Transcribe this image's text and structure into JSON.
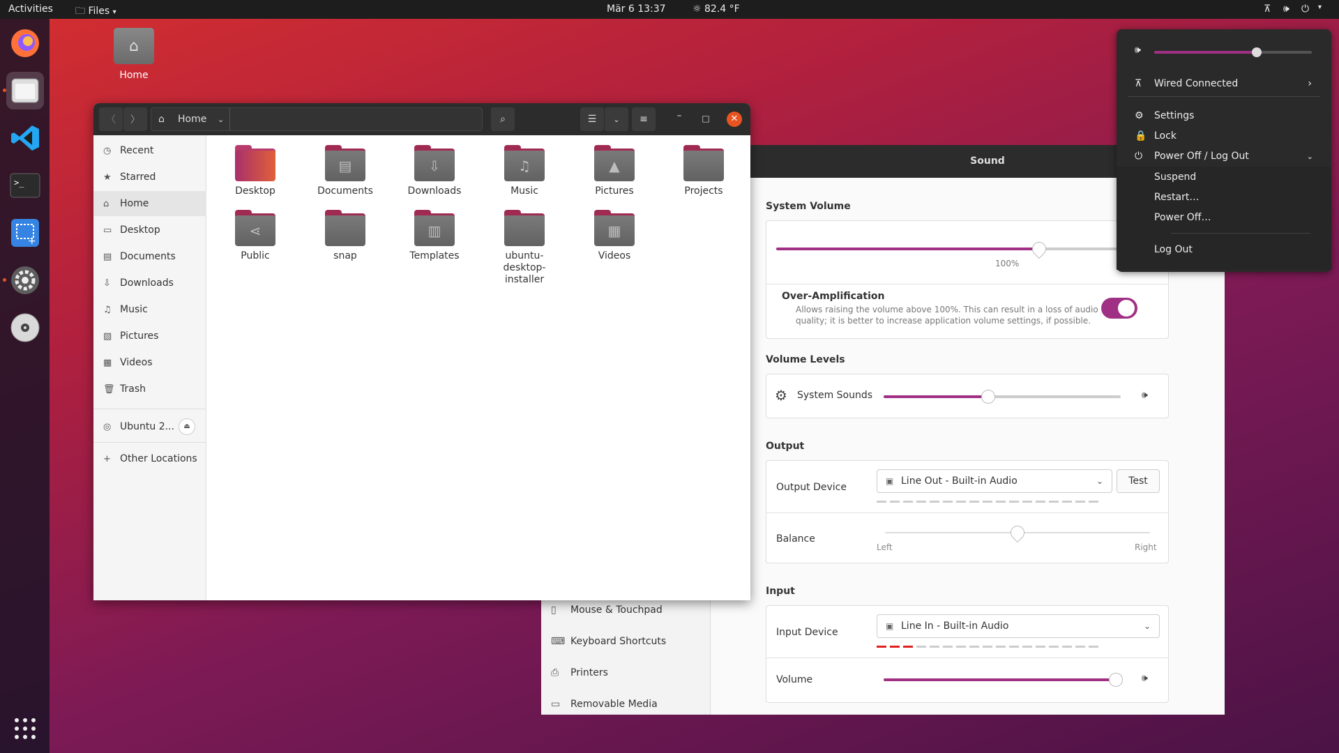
{
  "topbar": {
    "activities": "Activities",
    "app_menu": "Files",
    "clock": "Mär 6  13:37",
    "weather": "82.4 °F"
  },
  "desktop": {
    "home_label": "Home"
  },
  "settings": {
    "header_title": "Sound",
    "sidebar": [
      {
        "label": "Mouse & Touchpad",
        "icon": "mouse-icon"
      },
      {
        "label": "Keyboard Shortcuts",
        "icon": "keyboard-icon"
      },
      {
        "label": "Printers",
        "icon": "printer-icon"
      },
      {
        "label": "Removable Media",
        "icon": "usb-icon"
      }
    ],
    "system_volume": {
      "title": "System Volume",
      "percent_label": "100%",
      "level": 0.67
    },
    "over_amp": {
      "title": "Over-Amplification",
      "desc_line1": "Allows raising the volume above 100%. This can result in a loss of audio",
      "desc_line2": "quality; it is better to increase application volume settings, if possible.",
      "enabled": true
    },
    "volume_levels": {
      "title": "Volume Levels",
      "system_sounds": "System Sounds",
      "level": 0.44
    },
    "output": {
      "title": "Output",
      "device_label": "Output Device",
      "device": "Line Out - Built-in Audio",
      "test": "Test",
      "balance_label": "Balance",
      "left": "Left",
      "right": "Right",
      "balance": 0.5
    },
    "input": {
      "title": "Input",
      "device_label": "Input Device",
      "device": "Line In - Built-in Audio",
      "volume_label": "Volume",
      "level": 0.98,
      "active_meter_segments": 3
    }
  },
  "files": {
    "path": "Home",
    "sidebar": [
      {
        "label": "Recent",
        "icon": "clock-icon"
      },
      {
        "label": "Starred",
        "icon": "star-icon"
      },
      {
        "label": "Home",
        "icon": "home-icon",
        "selected": true
      },
      {
        "label": "Desktop",
        "icon": "desktop-icon"
      },
      {
        "label": "Documents",
        "icon": "document-icon"
      },
      {
        "label": "Downloads",
        "icon": "download-icon"
      },
      {
        "label": "Music",
        "icon": "music-icon"
      },
      {
        "label": "Pictures",
        "icon": "picture-icon"
      },
      {
        "label": "Videos",
        "icon": "video-icon"
      },
      {
        "label": "Trash",
        "icon": "trash-icon"
      }
    ],
    "drive": "Ubuntu 2...",
    "other_locations": "Other Locations",
    "items": [
      {
        "name": "Desktop",
        "icon": "desktop-folder-icon"
      },
      {
        "name": "Documents",
        "icon": "document-folder-icon"
      },
      {
        "name": "Downloads",
        "icon": "download-folder-icon"
      },
      {
        "name": "Music",
        "icon": "music-folder-icon"
      },
      {
        "name": "Pictures",
        "icon": "picture-folder-icon"
      },
      {
        "name": "Projects",
        "icon": "folder-icon"
      },
      {
        "name": "Public",
        "icon": "share-folder-icon"
      },
      {
        "name": "snap",
        "icon": "folder-icon"
      },
      {
        "name": "Templates",
        "icon": "template-folder-icon"
      },
      {
        "name": "ubuntu-desktop-installer",
        "icon": "folder-icon"
      },
      {
        "name": "Videos",
        "icon": "video-folder-icon"
      }
    ]
  },
  "system_menu": {
    "volume_level": 0.65,
    "wired": "Wired Connected",
    "settings": "Settings",
    "lock": "Lock",
    "power": "Power Off / Log Out",
    "suspend": "Suspend",
    "restart": "Restart…",
    "power_off": "Power Off…",
    "log_out": "Log Out"
  },
  "colors": {
    "accent": "#e95420",
    "slider": "#a03083",
    "panel": "#1d1d1d"
  }
}
